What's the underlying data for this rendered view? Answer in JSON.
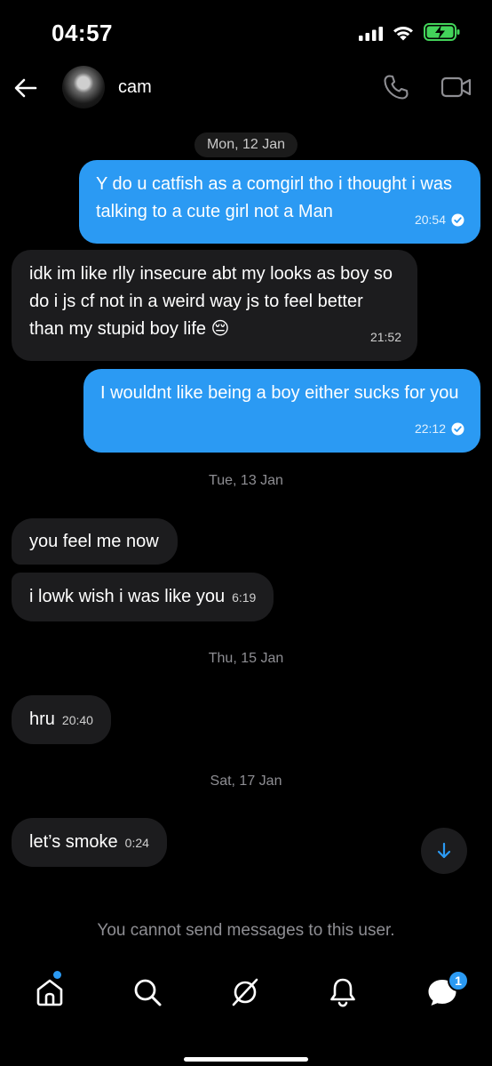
{
  "status_bar": {
    "time": "04:57"
  },
  "header": {
    "contact_name": "cam"
  },
  "messages": [
    {
      "type": "date",
      "text": "Mon, 12 Jan"
    },
    {
      "direction": "out",
      "text": "Y do u catfish as a comgirl tho i thought i was talking to a cute girl not a  Man",
      "time": "20:54",
      "read": true
    },
    {
      "direction": "in",
      "text": "idk im like rlly insecure abt my looks as boy so do i js cf not in a weird way js to feel better than my stupid boy life 😔",
      "time": "21:52"
    },
    {
      "direction": "out",
      "text": "I wouldnt like being a boy either sucks for you",
      "time": "22:12",
      "read": true
    },
    {
      "type": "date",
      "text": "Tue, 13 Jan"
    },
    {
      "direction": "in",
      "text": "you feel me now",
      "time": ""
    },
    {
      "direction": "in",
      "text": "i lowk wish i was like you",
      "time": "6:19"
    },
    {
      "type": "date",
      "text": "Thu, 15 Jan"
    },
    {
      "direction": "in",
      "text": "hru",
      "time": "20:40"
    },
    {
      "type": "date",
      "text": "Sat, 17 Jan"
    },
    {
      "direction": "in",
      "text": "let’s smoke",
      "time": "0:24"
    }
  ],
  "footer": {
    "blocked_note": "You cannot send messages to this user."
  },
  "tabs": {
    "items": [
      "home-icon",
      "search-icon",
      "explore-icon",
      "notifications-icon",
      "messages-icon"
    ],
    "messages_badge": "1"
  },
  "colors": {
    "accent": "#2b9af3",
    "incoming_bubble": "#1c1c1e",
    "background": "#000000"
  }
}
